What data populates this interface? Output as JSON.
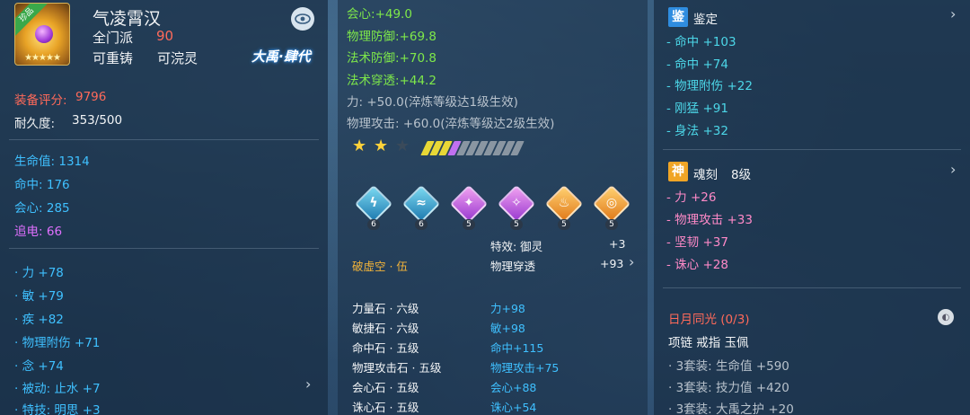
{
  "item": {
    "badge": "珍品",
    "name": "气凌霄汉",
    "sect": "全门派",
    "level": "90",
    "tag_recast": "可重铸",
    "tag_infuse": "可浣灵",
    "logo": "大禹·肆代",
    "score_label": "装备评分:",
    "score_value": "9796",
    "durability_label": "耐久度:",
    "durability_value": "353/500",
    "base_stats": [
      {
        "label": "生命值:",
        "value": "1314"
      },
      {
        "label": "命中:",
        "value": "176"
      },
      {
        "label": "会心:",
        "value": "285"
      },
      {
        "label": "追电:",
        "value": "66"
      }
    ],
    "extra_stats": [
      {
        "label": "力",
        "value": "+78"
      },
      {
        "label": "敏",
        "value": "+79"
      },
      {
        "label": "疾",
        "value": "+82"
      },
      {
        "label": "物理附伤",
        "value": "+71"
      },
      {
        "label": "念",
        "value": "+74"
      },
      {
        "label": "被动: 止水",
        "value": "+7"
      },
      {
        "label": "特技: 明思",
        "value": "+3"
      }
    ]
  },
  "middle": {
    "green_stats": [
      {
        "label": "会心:",
        "value": "+49.0"
      },
      {
        "label": "物理防御:",
        "value": "+69.8"
      },
      {
        "label": "法术防御:",
        "value": "+70.8"
      },
      {
        "label": "法术穿透:",
        "value": "+44.2"
      }
    ],
    "gray_stats": [
      "力: +50.0(淬炼等级达1级生效)",
      "物理攻击: +60.0(淬炼等级达2级生效)"
    ],
    "gem_numbers": [
      "6",
      "6",
      "5",
      "5",
      "5",
      "5"
    ],
    "effect_label": "特效: 御灵",
    "effect_value": "+3",
    "pierce_label": "物理穿透",
    "pierce_value": "+93",
    "set_name": "破虚空 · 伍",
    "gems": [
      {
        "name": "力量石 · 六级",
        "value": "力+98"
      },
      {
        "name": "敏捷石 · 六级",
        "value": "敏+98"
      },
      {
        "name": "命中石 · 五级",
        "value": "命中+115"
      },
      {
        "name": "物理攻击石 · 五级",
        "value": "物理攻击+75"
      },
      {
        "name": "会心石 · 五级",
        "value": "会心+88"
      },
      {
        "name": "诛心石 · 五级",
        "value": "诛心+54"
      }
    ]
  },
  "right": {
    "appraise_tag": "鉴",
    "appraise_title": "鉴定",
    "appraise_stats": [
      {
        "label": "- 命中",
        "value": "+103"
      },
      {
        "label": "- 命中",
        "value": "+74"
      },
      {
        "label": "- 物理附伤",
        "value": "+22"
      },
      {
        "label": "- 刚猛",
        "value": "+91"
      },
      {
        "label": "- 身法",
        "value": "+32"
      }
    ],
    "soul_tag": "神",
    "soul_title": "魂刻",
    "soul_level": "8级",
    "soul_stats": [
      {
        "label": "- 力",
        "value": "+26"
      },
      {
        "label": "- 物理攻击",
        "value": "+33"
      },
      {
        "label": "- 坚韧",
        "value": "+37"
      },
      {
        "label": "- 诛心",
        "value": "+28"
      }
    ],
    "set_title": "日月同光 (0/3)",
    "set_parts": "项链  戒指  玉佩",
    "set_bonuses": [
      {
        "label": "·  3套装: 生命值",
        "value": "+590"
      },
      {
        "label": "·  3套装: 技力值",
        "value": "+420"
      },
      {
        "label": "·  3套装: 大禹之护",
        "value": "+20"
      }
    ]
  },
  "colors": {
    "green": "#7ee84a",
    "cyan": "#4cd7e8",
    "blue": "#3fc0ff",
    "red": "#ff6a5a",
    "pink": "#ff8ac8",
    "purple": "#e070ff",
    "gold": "#f1b33a"
  },
  "icons": {
    "eye": "eye-icon",
    "chevron": "chevron-right-icon",
    "circle": "info-circle-icon"
  }
}
